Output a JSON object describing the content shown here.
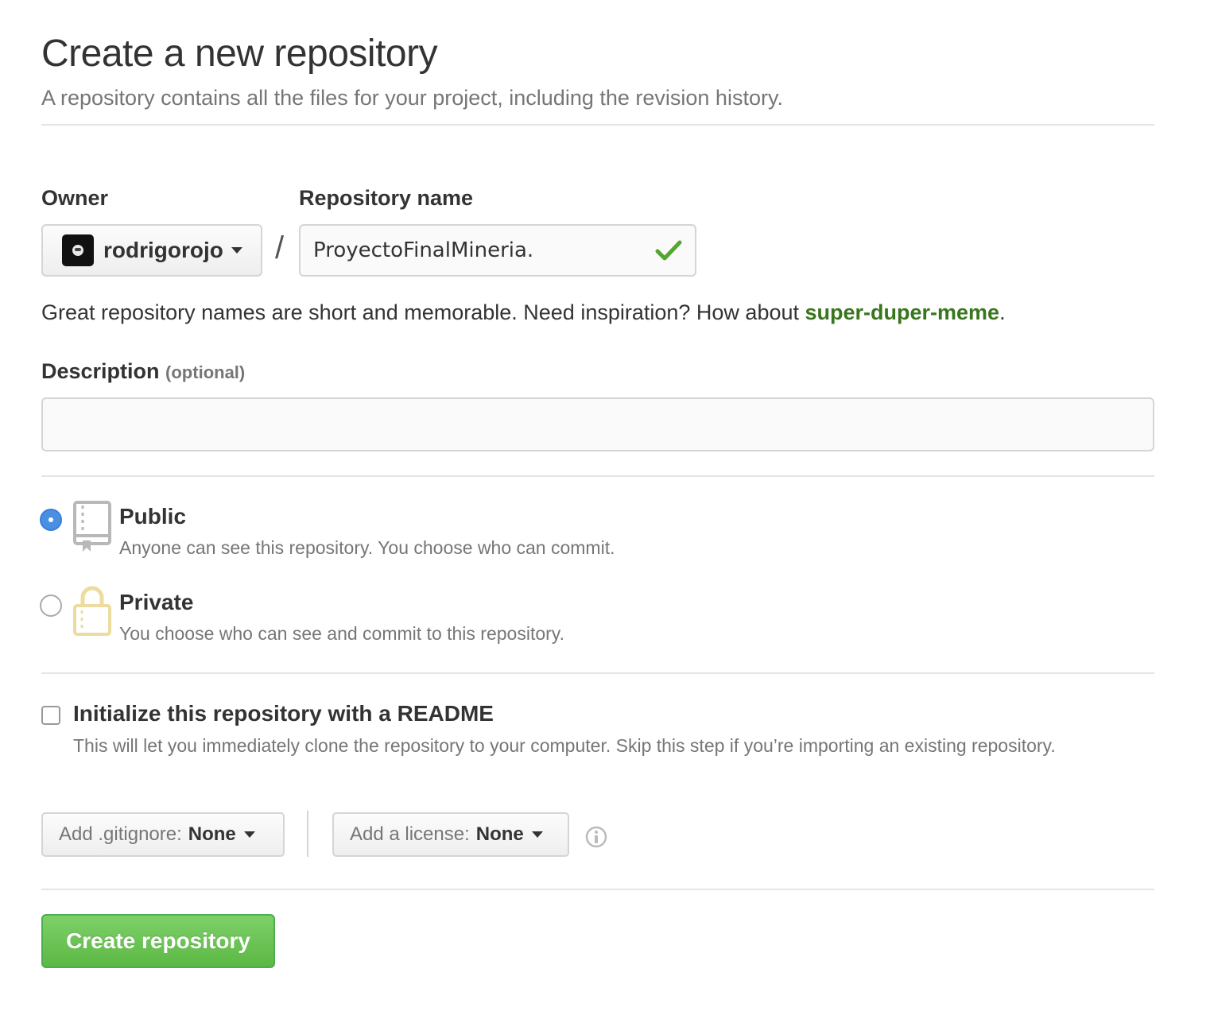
{
  "header": {
    "title": "Create a new repository",
    "subtitle": "A repository contains all the files for your project, including the revision history."
  },
  "owner": {
    "label": "Owner",
    "value": "rodrigorojo"
  },
  "separator": "/",
  "repo_name": {
    "label": "Repository name",
    "value": "ProyectoFinalMineria."
  },
  "hint": {
    "text": "Great repository names are short and memorable. Need inspiration? How about ",
    "suggestion": "super-duper-meme",
    "end": "."
  },
  "description": {
    "label": "Description",
    "note": "(optional)",
    "value": "",
    "placeholder": ""
  },
  "visibility": {
    "selected": "public",
    "public": {
      "title": "Public",
      "desc": "Anyone can see this repository. You choose who can commit."
    },
    "private": {
      "title": "Private",
      "desc": "You choose who can see and commit to this repository."
    }
  },
  "readme": {
    "checked": false,
    "title": "Initialize this repository with a README",
    "desc": "This will let you immediately clone the repository to your computer. Skip this step if you’re importing an existing repository."
  },
  "gitignore": {
    "label": "Add .gitignore:",
    "value": "None"
  },
  "license": {
    "label": "Add a license:",
    "value": "None"
  },
  "submit": {
    "label": "Create repository"
  },
  "colors": {
    "accent_green": "#38761d",
    "button_green": "#5cb844",
    "radio_blue": "#4a90e2",
    "check_green": "#55a532",
    "private_lock": "#ecdca0"
  },
  "icons": [
    "owner-avatar",
    "chevron-down-icon",
    "check-icon",
    "repo-book-icon",
    "lock-icon",
    "info-icon"
  ]
}
